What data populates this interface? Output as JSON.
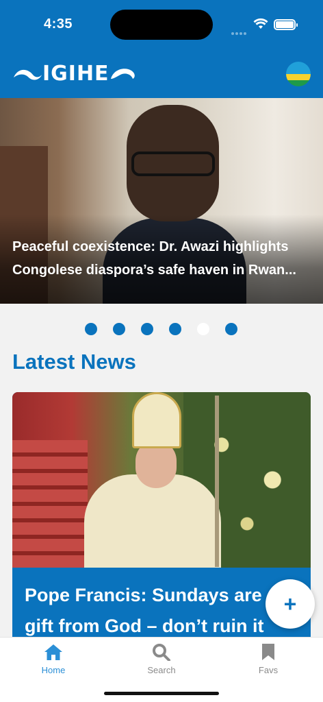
{
  "status_bar": {
    "time": "4:35"
  },
  "header": {
    "logo_text": "IGIHE",
    "flag_icon": "rwanda-flag-icon"
  },
  "hero": {
    "title_line1": "Peaceful coexistence: Dr. Awazi highlights",
    "title_line2": "Congolese diaspora’s safe haven in Rwan..."
  },
  "carousel": {
    "total": 6,
    "active_index": 4
  },
  "latest": {
    "section_title": "Latest News",
    "card": {
      "title_line1": "Pope Francis: Sundays are",
      "title_line2": "gift from God – don’t ruin it"
    }
  },
  "fab": {
    "icon": "plus-icon"
  },
  "tabbar": {
    "items": [
      {
        "label": "Home",
        "icon": "home-icon"
      },
      {
        "label": "Search",
        "icon": "search-icon"
      },
      {
        "label": "Favs",
        "icon": "bookmark-icon"
      }
    ]
  },
  "colors": {
    "primary": "#0a73bd",
    "active_tab": "#2b8fd6",
    "inactive_tab": "#8a8a8a"
  }
}
